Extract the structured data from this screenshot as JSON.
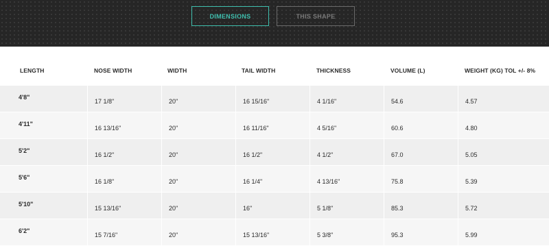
{
  "tabs": {
    "dimensions": "DIMENSIONS",
    "this_shape": "THIS SHAPE"
  },
  "colors": {
    "accent": "#3fbfae",
    "dark_bg": "#262626"
  },
  "table": {
    "headers": [
      "LENGTH",
      "NOSE WIDTH",
      "WIDTH",
      "TAIL WIDTH",
      "THICKNESS",
      "VOLUME (L)",
      "WEIGHT (KG) TOL +/- 8%"
    ],
    "rows": [
      [
        "4'8\"",
        "17 1/8\"",
        "20\"",
        "16 15/16\"",
        "4 1/16\"",
        "54.6",
        "4.57"
      ],
      [
        "4'11\"",
        "16 13/16\"",
        "20\"",
        "16 11/16\"",
        "4 5/16\"",
        "60.6",
        "4.80"
      ],
      [
        "5'2\"",
        "16 1/2\"",
        "20\"",
        "16 1/2\"",
        "4 1/2\"",
        "67.0",
        "5.05"
      ],
      [
        "5'6\"",
        "16 1/8\"",
        "20\"",
        "16 1/4\"",
        "4 13/16\"",
        "75.8",
        "5.39"
      ],
      [
        "5'10\"",
        "15 13/16\"",
        "20\"",
        "16\"",
        "5 1/8\"",
        "85.3",
        "5.72"
      ],
      [
        "6'2\"",
        "15 7/16\"",
        "20\"",
        "15 13/16\"",
        "5 3/8\"",
        "95.3",
        "5.99"
      ]
    ]
  }
}
